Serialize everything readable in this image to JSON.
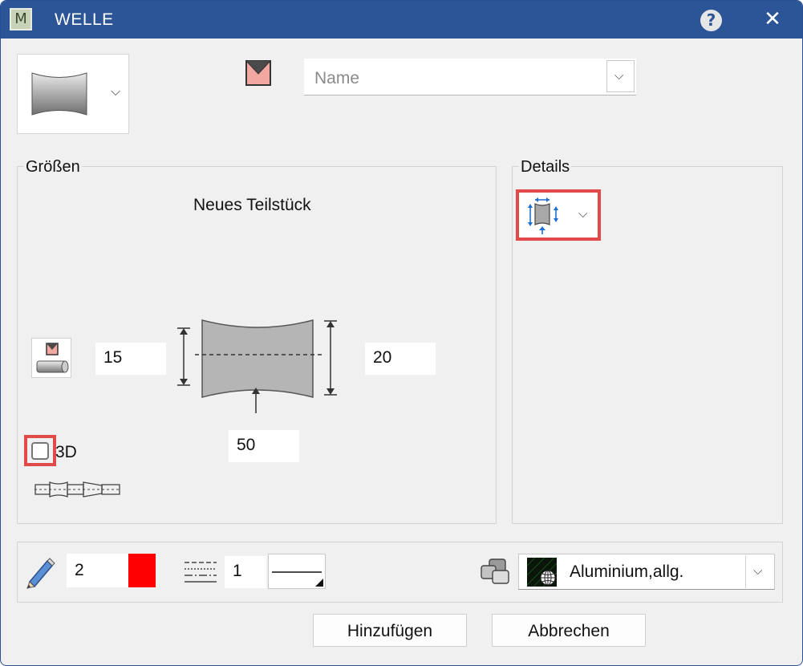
{
  "window": {
    "title": "WELLE",
    "app_icon_letter": "M",
    "help_glyph": "?",
    "close_glyph": "✕"
  },
  "top": {
    "shape_select_icon": "concave-shaft-segment-icon",
    "marker_icon": "pink-marker-icon",
    "name_placeholder": "Name",
    "name_value": ""
  },
  "sizes_group": {
    "label": "Größen",
    "heading": "Neues Teilstück",
    "left_diameter": "15",
    "right_diameter": "20",
    "length": "50",
    "checkbox_3d_label": "3D",
    "checkbox_3d_checked": false
  },
  "details_group": {
    "label": "Details",
    "selected_icon": "dimension-shaft-icon"
  },
  "bottom": {
    "pen_width": "2",
    "pen_color": "#ff0000",
    "line_type": "1",
    "material": "Aluminium,allg."
  },
  "buttons": {
    "add": "Hinzufügen",
    "cancel": "Abbrechen"
  },
  "colors": {
    "titlebar": "#2b5597",
    "highlight": "#e24a4a",
    "accent_blue": "#1f6fd1"
  }
}
